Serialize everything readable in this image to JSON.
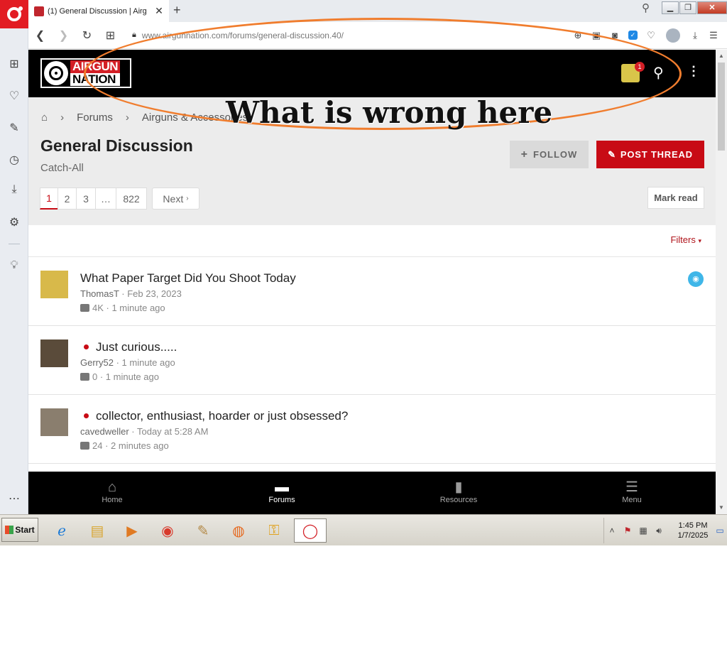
{
  "browser": {
    "tab_title": "(1) General Discussion | Airg",
    "url": "www.airgunnation.com/forums/general-discussion.40/"
  },
  "site": {
    "logo_line1": "AIRGUN",
    "logo_line2": "NATION",
    "alert_count": "1"
  },
  "breadcrumb": [
    "Forums",
    "Airguns & Accessories"
  ],
  "forum": {
    "title": "General Discussion",
    "description": "Catch-All",
    "follow_label": "FOLLOW",
    "post_label": "POST THREAD",
    "mark_read_label": "Mark read",
    "filters_label": "Filters"
  },
  "pagination": {
    "pages": [
      "1",
      "2",
      "3",
      "…",
      "822"
    ],
    "next_label": "Next"
  },
  "threads": [
    {
      "title": "What Paper Target Did You Shoot Today",
      "author": "ThomasT",
      "date": "Feb 23, 2023",
      "replies": "4K",
      "last": "1 minute ago",
      "unread": false,
      "watched": true,
      "avatar_color": "#d8b94a"
    },
    {
      "title": "Just curious.....",
      "author": "Gerry52",
      "date": "1 minute ago",
      "replies": "0",
      "last": "1 minute ago",
      "unread": true,
      "watched": false,
      "avatar_color": "#5a4b3a"
    },
    {
      "title": "collector, enthusiast, hoarder or just obsessed?",
      "author": "cavedweller",
      "date": "Today at 5:28 AM",
      "replies": "24",
      "last": "2 minutes ago",
      "unread": true,
      "watched": false,
      "avatar_color": "#8a7e6e"
    }
  ],
  "bottom_nav": [
    {
      "label": "Home",
      "icon": "home-icon"
    },
    {
      "label": "Forums",
      "icon": "forums-icon"
    },
    {
      "label": "Resources",
      "icon": "resources-icon"
    },
    {
      "label": "Menu",
      "icon": "menu-icon"
    }
  ],
  "annotation": {
    "text": "What is wrong here",
    "color": "#f07d2e"
  },
  "taskbar": {
    "start_label": "Start",
    "time": "1:45 PM",
    "date": "1/7/2025"
  },
  "colors": {
    "brand_red": "#c80b15",
    "header_bg": "#000000",
    "watch_blue": "#3fb6e8"
  }
}
